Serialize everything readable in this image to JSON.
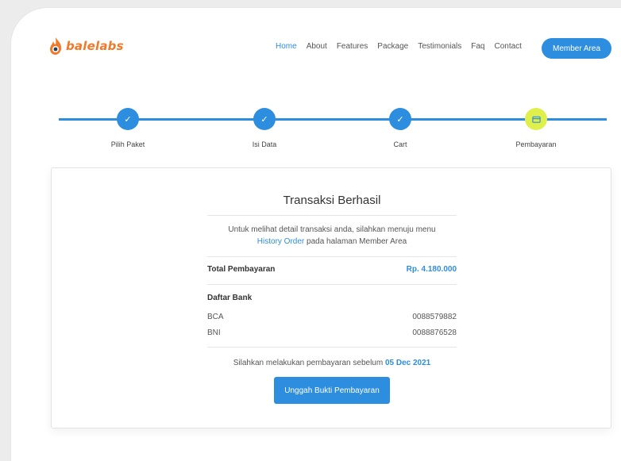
{
  "brand": {
    "name": "balelabs",
    "icon": "flame-icon",
    "color": "#f07a2a"
  },
  "nav": {
    "links": [
      {
        "label": "Home",
        "active": true
      },
      {
        "label": "About",
        "active": false
      },
      {
        "label": "Features",
        "active": false
      },
      {
        "label": "Package",
        "active": false
      },
      {
        "label": "Testimonials",
        "active": false
      },
      {
        "label": "Faq",
        "active": false
      },
      {
        "label": "Contact",
        "active": false
      }
    ],
    "member_button": "Member Area"
  },
  "steps": [
    {
      "label": "Pilih Paket",
      "icon": "check-icon",
      "status": "done"
    },
    {
      "label": "Isi Data",
      "icon": "check-icon",
      "status": "done"
    },
    {
      "label": "Cart",
      "icon": "check-icon",
      "status": "done"
    },
    {
      "label": "Pembayaran",
      "icon": "wallet-icon",
      "status": "current"
    }
  ],
  "card": {
    "title": "Transaksi Berhasil",
    "info_line1": "Untuk melihat detail transaksi anda, silahkan menuju menu",
    "info_link": "History Order",
    "info_line2": " pada halaman Member Area",
    "total_label": "Total Pembayaran",
    "total_amount": "Rp. 4.180.000",
    "bank_title": "Daftar Bank",
    "banks": [
      {
        "name": "BCA",
        "account": "0088579882"
      },
      {
        "name": "BNI",
        "account": "0088876528"
      }
    ],
    "deadline_text": "Silahkan melakukan pembayaran sebelum ",
    "deadline_date": "05 Dec 2021",
    "upload_button": "Unggah Bukti Pembayaran"
  },
  "colors": {
    "accent": "#2d8ddf",
    "current_step": "#dff04a"
  }
}
